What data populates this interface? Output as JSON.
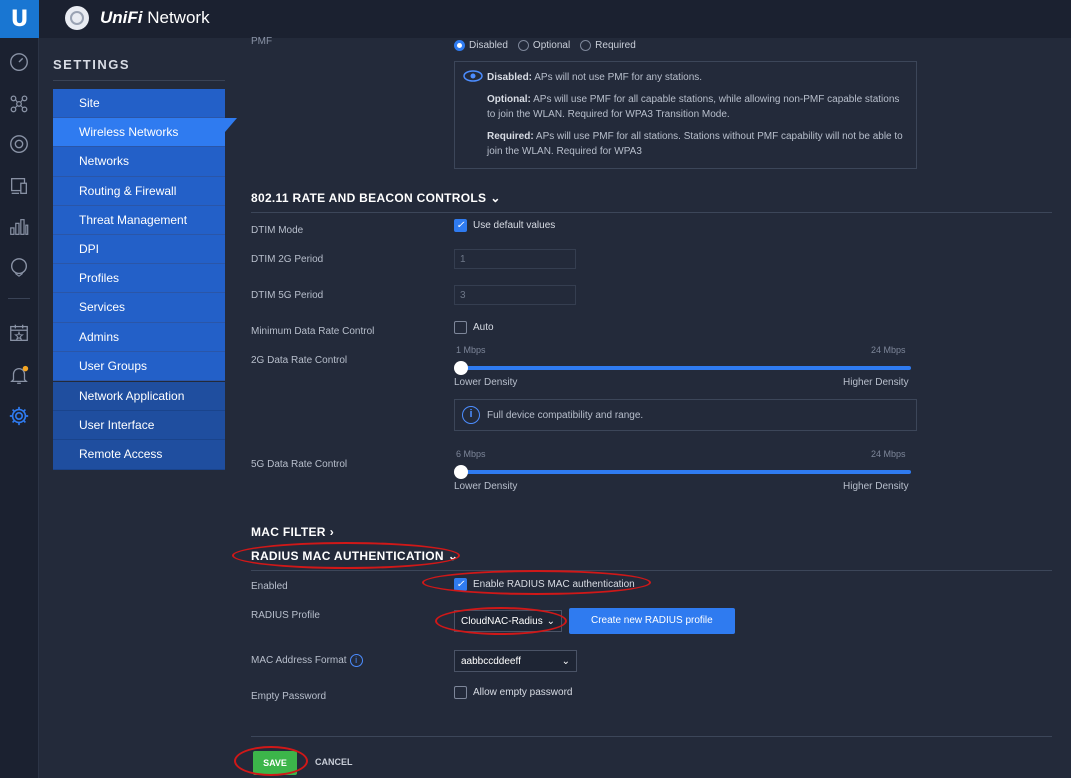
{
  "app": {
    "logo_letter": "U",
    "brand_italic": "UniFi",
    "brand_rest": " Network"
  },
  "nav": {
    "icons": [
      "dashboard-icon",
      "topology-icon",
      "devices-icon",
      "clients-icon",
      "statistics-icon",
      "insights-icon",
      "events-icon",
      "alerts-icon",
      "settings-icon"
    ]
  },
  "settings": {
    "title": "SETTINGS",
    "menu": [
      "Site",
      "Wireless Networks",
      "Networks",
      "Routing & Firewall",
      "Threat Management",
      "DPI",
      "Profiles",
      "Services",
      "Admins",
      "User Groups"
    ],
    "menu_active": "Wireless Networks",
    "menu2": [
      "Network Application",
      "User Interface",
      "Remote Access"
    ]
  },
  "pmf": {
    "label": "PMF",
    "options": [
      "Disabled",
      "Optional",
      "Required"
    ],
    "selected": "Disabled",
    "info": {
      "disabled_head": "Disabled:",
      "disabled_text": " APs will not use PMF for any stations.",
      "optional_head": "Optional:",
      "optional_text": " APs will use PMF for all capable stations, while allowing non-PMF capable stations to join the WLAN. Required for WPA3 Transition Mode.",
      "required_head": "Required:",
      "required_text": " APs will use PMF for all stations. Stations without PMF capability will not be able to join the WLAN. Required for WPA3"
    }
  },
  "rate_section": {
    "title": "802.11 RATE AND BEACON CONTROLS",
    "dtim_mode_label": "DTIM Mode",
    "dtim_mode_checkbox": "Use default values",
    "dtim_mode_checked": true,
    "dtim_2g_label": "DTIM 2G Period",
    "dtim_2g_value": "1",
    "dtim_5g_label": "DTIM 5G Period",
    "dtim_5g_value": "3",
    "min_rate_label": "Minimum Data Rate Control",
    "min_rate_checkbox": "Auto",
    "min_rate_checked": false,
    "rate_2g_label": "2G Data Rate Control",
    "rate_2g_min": "1 Mbps",
    "rate_2g_max": "24 Mbps",
    "rate_5g_label": "5G Data Rate Control",
    "rate_5g_min": "6 Mbps",
    "rate_5g_max": "24 Mbps",
    "lower_density": "Lower Density",
    "higher_density": "Higher Density",
    "compat_info": "Full device compatibility and range."
  },
  "mac_filter": {
    "title": "MAC FILTER"
  },
  "radius": {
    "title": "RADIUS MAC AUTHENTICATION",
    "enabled_label": "Enabled",
    "enabled_checkbox": "Enable RADIUS MAC authentication",
    "enabled_checked": true,
    "profile_label": "RADIUS Profile",
    "profile_value": "CloudNAC-Radius",
    "create_profile_button": "Create new RADIUS profile",
    "mac_format_label": "MAC Address Format",
    "mac_format_value": "aabbccddeeff",
    "empty_pw_label": "Empty Password",
    "empty_pw_checkbox": "Allow empty password",
    "empty_pw_checked": false
  },
  "actions": {
    "save": "SAVE",
    "cancel": "CANCEL"
  },
  "colors": {
    "accent": "#2f7bf0",
    "save": "#3cb54a",
    "annotation": "#d01818"
  }
}
